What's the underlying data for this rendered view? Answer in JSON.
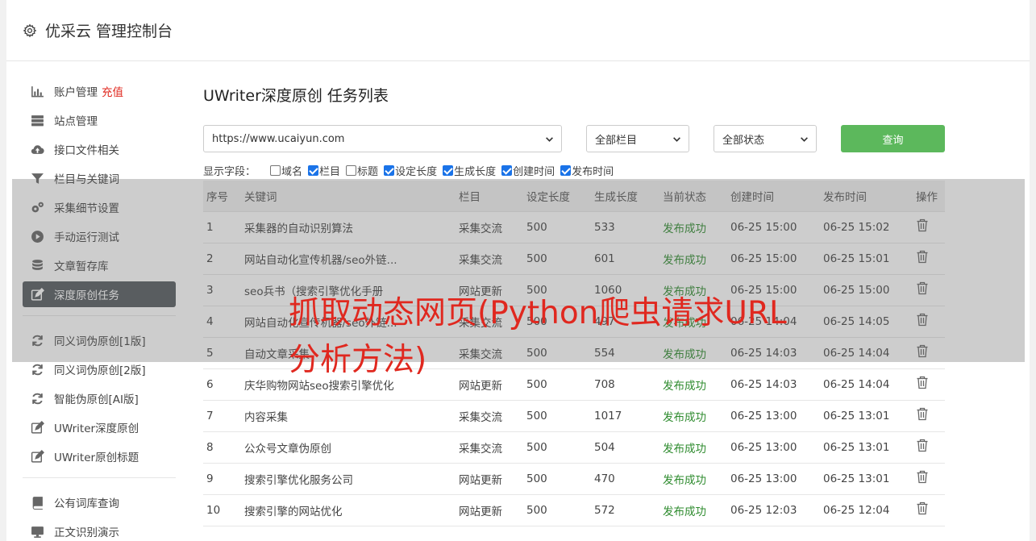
{
  "header": {
    "title": "优采云 管理控制台"
  },
  "sidebar": {
    "items": [
      {
        "label": "账户管理",
        "extra": "充值",
        "icon": "bar-chart-icon"
      },
      {
        "label": "站点管理",
        "icon": "server-icon"
      },
      {
        "label": "接口文件相关",
        "icon": "cloud-upload-icon"
      },
      {
        "label": "栏目与关键词",
        "icon": "filter-icon"
      },
      {
        "label": "采集细节设置",
        "icon": "gears-icon"
      },
      {
        "label": "手动运行测试",
        "icon": "play-circle-icon"
      },
      {
        "label": "文章暂存库",
        "icon": "database-icon"
      },
      {
        "label": "深度原创任务",
        "icon": "edit-icon"
      },
      {
        "label": "同义词伪原创[1版]",
        "icon": "refresh-icon"
      },
      {
        "label": "同义词伪原创[2版]",
        "icon": "refresh-icon"
      },
      {
        "label": "智能伪原创[AI版]",
        "icon": "refresh-icon"
      },
      {
        "label": "UWriter深度原创",
        "icon": "edit-icon"
      },
      {
        "label": "UWriter原创标题",
        "icon": "edit-icon"
      },
      {
        "label": "公有词库查询",
        "icon": "book-icon"
      },
      {
        "label": "正文识别演示",
        "icon": "monitor-icon"
      }
    ]
  },
  "main": {
    "title": "UWriter深度原创 任务列表",
    "site_select": "https://www.ucaiyun.com",
    "column_select": "全部栏目",
    "status_select": "全部状态",
    "query_button": "查询",
    "fields_label": "显示字段：",
    "fields": [
      {
        "label": "域名",
        "checked": false
      },
      {
        "label": "栏目",
        "checked": true
      },
      {
        "label": "标题",
        "checked": false
      },
      {
        "label": "设定长度",
        "checked": true
      },
      {
        "label": "生成长度",
        "checked": true
      },
      {
        "label": "创建时间",
        "checked": true
      },
      {
        "label": "发布时间",
        "checked": true
      }
    ],
    "table": {
      "headers": [
        "序号",
        "关键词",
        "栏目",
        "设定长度",
        "生成长度",
        "当前状态",
        "创建时间",
        "发布时间",
        "操作"
      ],
      "rows": [
        [
          "1",
          "采集器的自动识别算法",
          "采集交流",
          "500",
          "533",
          "发布成功",
          "06-25 15:00",
          "06-25 15:02"
        ],
        [
          "2",
          "网站自动化宣传机器/seo外链...",
          "采集交流",
          "500",
          "601",
          "发布成功",
          "06-25 15:00",
          "06-25 15:01"
        ],
        [
          "3",
          "seo兵书（搜索引擎优化手册",
          "网站更新",
          "500",
          "1060",
          "发布成功",
          "06-25 15:00",
          "06-25 15:00"
        ],
        [
          "4",
          "网站自动化宣传机器/seo外链...",
          "采集交流",
          "500",
          "497",
          "发布成功",
          "06-25 14:04",
          "06-25 14:05"
        ],
        [
          "5",
          "自动文章采集",
          "采集交流",
          "500",
          "554",
          "发布成功",
          "06-25 14:03",
          "06-25 14:04"
        ],
        [
          "6",
          "庆华购物网站seo搜索引擎优化",
          "网站更新",
          "500",
          "708",
          "发布成功",
          "06-25 14:03",
          "06-25 14:04"
        ],
        [
          "7",
          "内容采集",
          "采集交流",
          "500",
          "1017",
          "发布成功",
          "06-25 13:00",
          "06-25 13:01"
        ],
        [
          "8",
          "公众号文章伪原创",
          "采集交流",
          "500",
          "504",
          "发布成功",
          "06-25 13:00",
          "06-25 13:01"
        ],
        [
          "9",
          "搜索引擎优化服务公司",
          "网站更新",
          "500",
          "470",
          "发布成功",
          "06-25 13:00",
          "06-25 13:01"
        ],
        [
          "10",
          "搜索引擎的网站优化",
          "网站更新",
          "500",
          "572",
          "发布成功",
          "06-25 12:03",
          "06-25 12:04"
        ]
      ]
    }
  },
  "banner": {
    "text": "抓取动态网页(Python爬虫请求URL分析方法)"
  },
  "colors": {
    "success": "#2e8b2e",
    "query_button": "#5cb85c",
    "accent_red": "#e0281f",
    "active_nav": "#555a5f"
  }
}
